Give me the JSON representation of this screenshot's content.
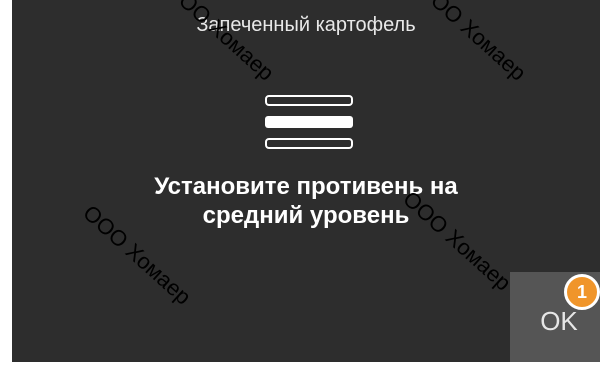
{
  "screen": {
    "title": "Запеченный картофель",
    "instruction_line1": "Установите противень на",
    "instruction_line2": "средний уровень",
    "icon": "oven-rack-middle-icon",
    "ok_label": "OK",
    "callout_number": "1"
  },
  "watermark": {
    "text": "ООО Хомаер"
  },
  "colors": {
    "screen_bg": "#2d2d2d",
    "ok_bg": "#555555",
    "callout": "#f0952a"
  }
}
